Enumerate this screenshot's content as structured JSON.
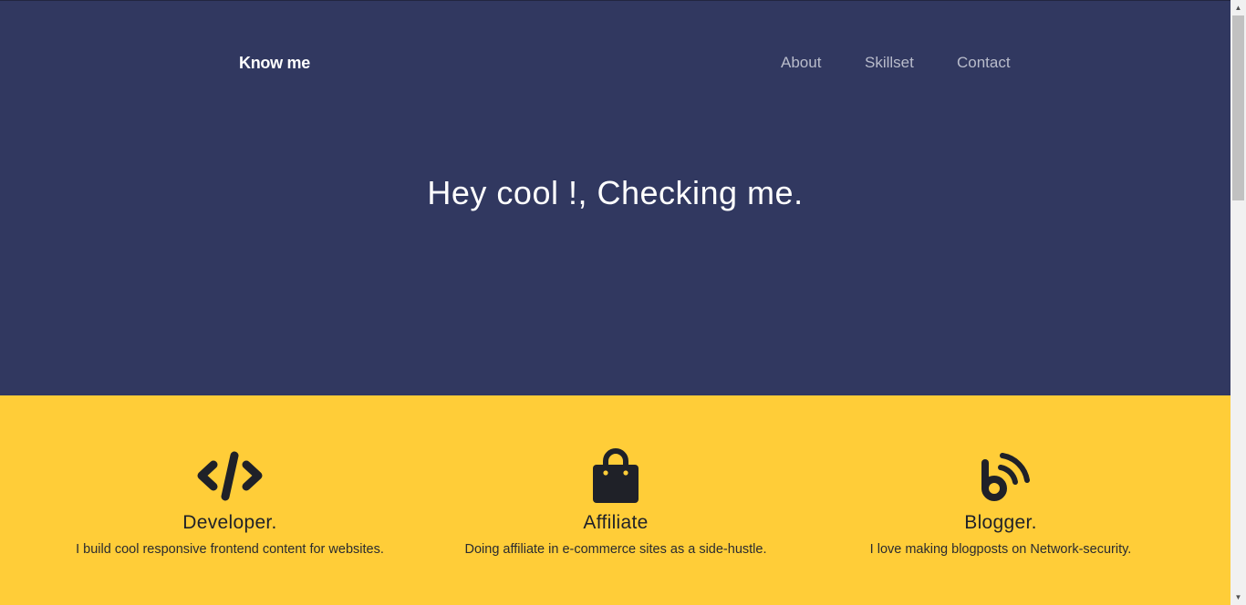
{
  "header": {
    "brand": "Know me",
    "nav": [
      {
        "label": "About"
      },
      {
        "label": "Skillset"
      },
      {
        "label": "Contact"
      }
    ]
  },
  "hero": {
    "title": "Hey cool !, Checking me."
  },
  "features": [
    {
      "icon": "code-icon",
      "title": "Developer.",
      "description": "I build cool responsive frontend content for websites."
    },
    {
      "icon": "shopping-bag-icon",
      "title": "Affiliate",
      "description": "Doing affiliate in e-commerce sites as a side-hustle."
    },
    {
      "icon": "blogger-icon",
      "title": "Blogger.",
      "description": "I love making blogposts on Network-security."
    }
  ],
  "colors": {
    "hero_bg": "#313860",
    "features_bg": "#ffcd38",
    "text_dark": "#1f2128",
    "nav_text": "#b9bccb"
  },
  "scrollbar": {
    "up_icon": "scroll-up-arrow-icon",
    "down_icon": "scroll-down-arrow-icon"
  }
}
